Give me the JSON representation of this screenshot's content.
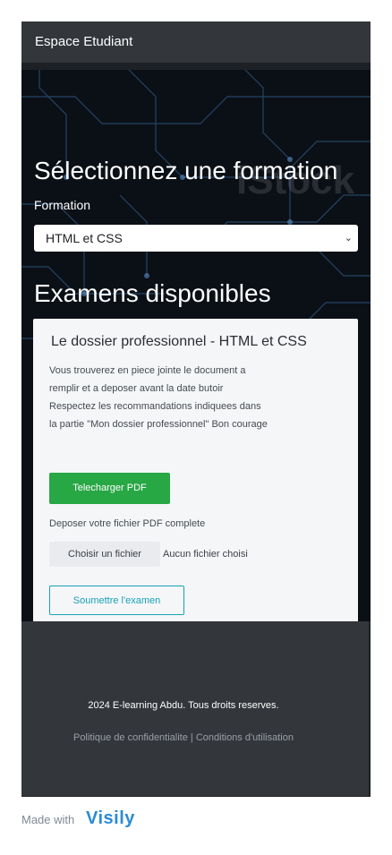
{
  "header": {
    "title": "Espace Etudiant"
  },
  "hero": {
    "heading": "Sélectionnez une formation",
    "formation_label": "Formation",
    "formation_selected": "HTML et CSS",
    "exams_heading": "Examens disponibles"
  },
  "exam_card": {
    "title": "Le dossier professionnel - HTML et CSS",
    "description_lines": [
      "Vous trouverez en piece jointe le document a",
      "remplir et a deposer avant la date butoir",
      "Respectez les recommandations indiquees dans",
      "la partie \"Mon dossier professionnel\" Bon courage"
    ],
    "download_button": "Telecharger PDF",
    "upload_label": "Deposer votre fichier PDF complete",
    "choose_file_button": "Choisir un fichier",
    "file_status": "Aucun fichier choisi",
    "submit_button": "Soumettre l'examen"
  },
  "footer": {
    "copyright": "2024 E-learning Abdu. Tous droits reserves.",
    "links": "Politique de confidentialite | Conditions d'utilisation"
  },
  "badge": {
    "made_with": "Made with",
    "brand": "Visily"
  },
  "watermark": "iStock",
  "colors": {
    "topbar": "#33363b",
    "hero_bg": "#0b1016",
    "card_bg": "#f5f6f8",
    "download": "#28a745",
    "submit_outline": "#17a2b8",
    "brand": "#2a8bd7"
  },
  "icons": {
    "select_arrow": "chevron-down-icon",
    "brand_logo": "visily-logo-icon"
  }
}
